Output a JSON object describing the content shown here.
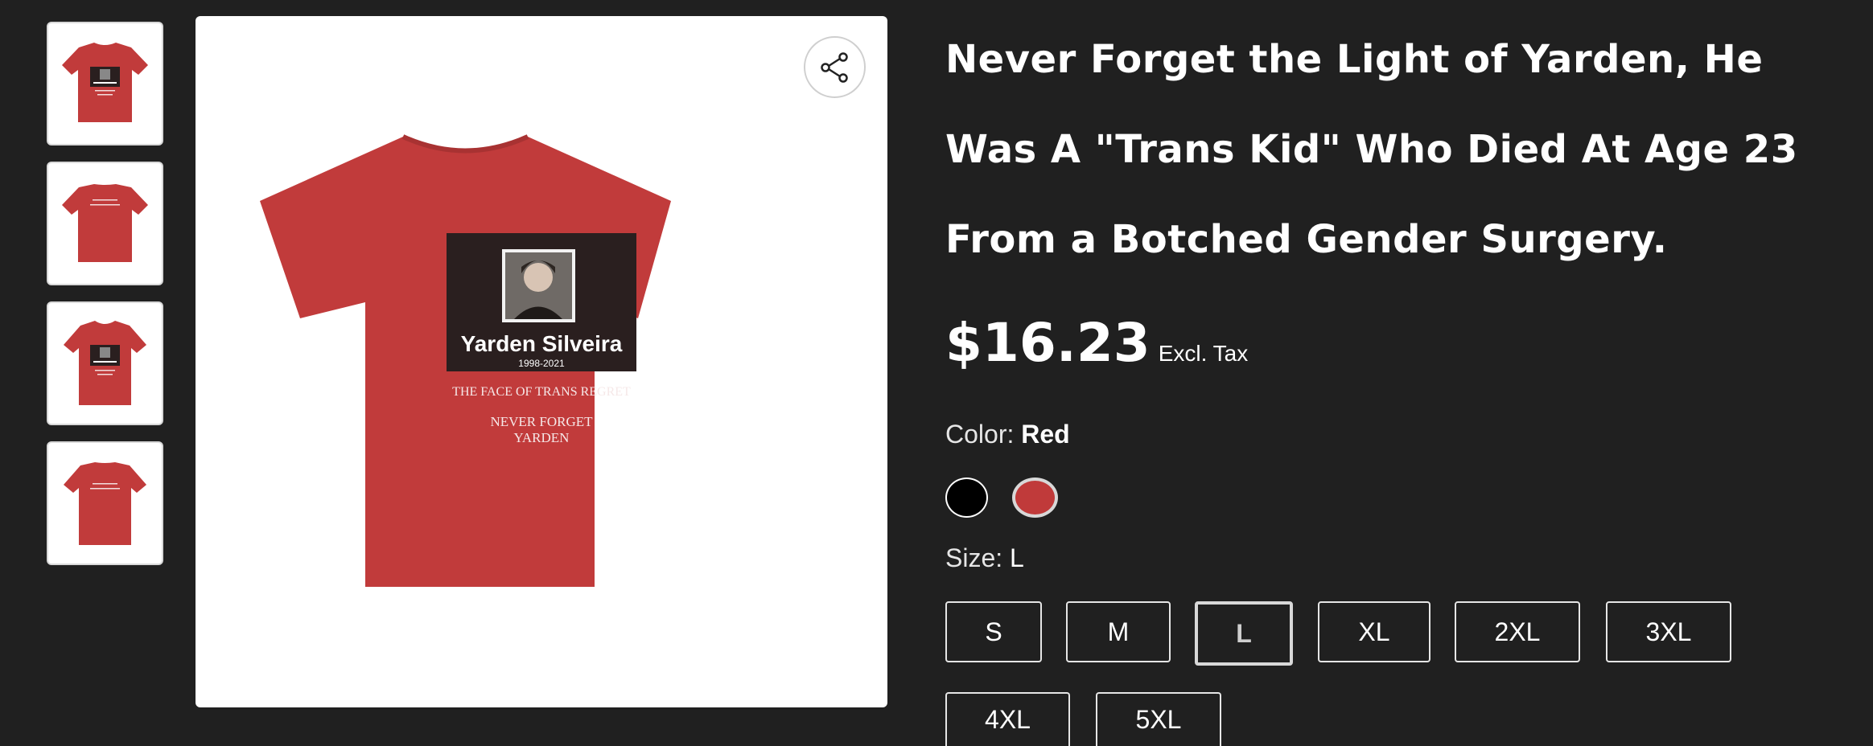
{
  "thumbnails": [
    {
      "alt": "front-view"
    },
    {
      "alt": "back-view"
    },
    {
      "alt": "worn-front-view"
    },
    {
      "alt": "worn-back-view"
    }
  ],
  "main_image": {
    "print_name": "Yarden Silveira",
    "print_years": "1998-2021",
    "print_line1": "THE FACE OF TRANS REGRET",
    "print_line2": "NEVER FORGET",
    "print_line3": "YARDEN",
    "shirt_color": "#c13b3b"
  },
  "share": {
    "icon": "share-icon"
  },
  "product": {
    "title": "Never Forget the Light of Yarden, He Was A \"Trans Kid\" Who Died At Age 23 From a Botched Gender Surgery.",
    "price": "$16.23",
    "tax_note": "Excl. Tax"
  },
  "color": {
    "label": "Color:",
    "selected": "Red",
    "options": [
      {
        "name": "Black",
        "hex": "#000000"
      },
      {
        "name": "Red",
        "hex": "#c03a3a"
      }
    ]
  },
  "size": {
    "label": "Size:",
    "selected": "L",
    "options": [
      "S",
      "M",
      "L",
      "XL",
      "2XL",
      "3XL",
      "4XL",
      "5XL"
    ]
  }
}
